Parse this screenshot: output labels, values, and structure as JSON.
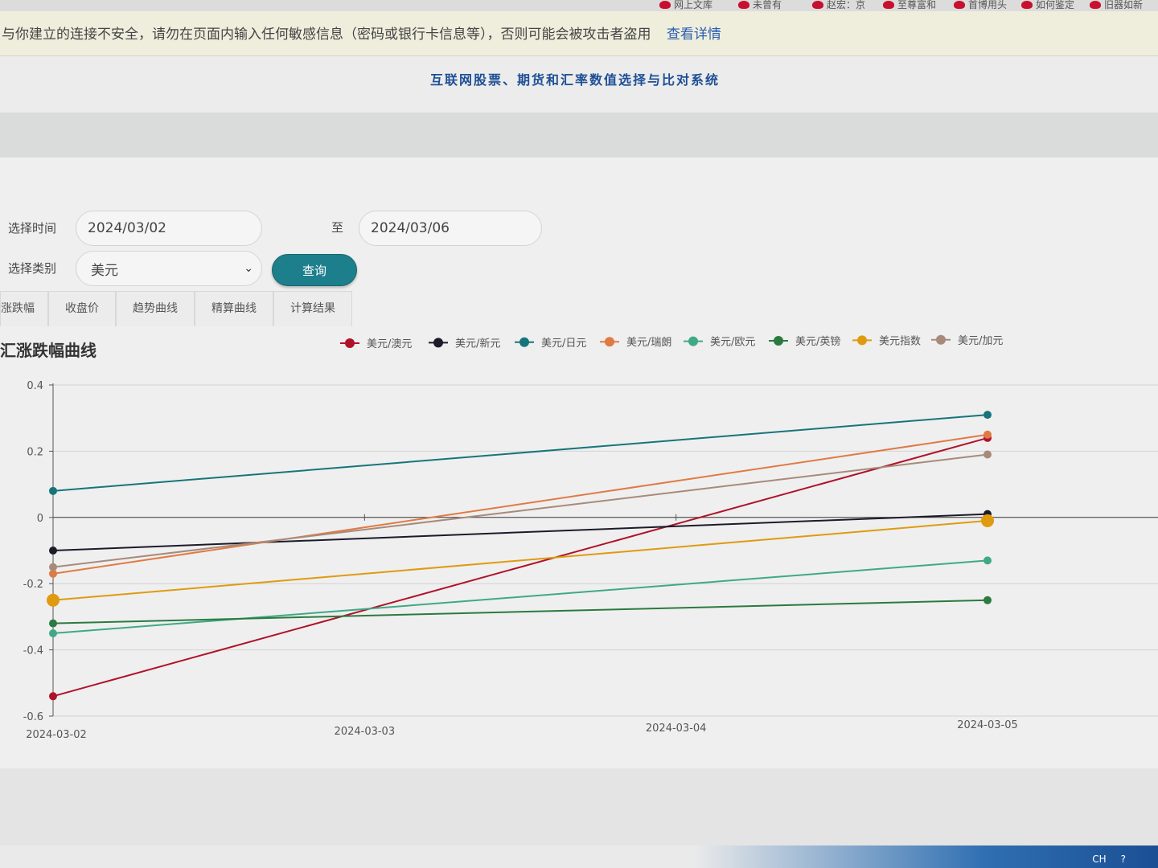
{
  "bookmarks": [
    {
      "label": "网上文库"
    },
    {
      "label": "未曾有"
    },
    {
      "label": "赵宏：京"
    },
    {
      "label": "至尊富和"
    },
    {
      "label": "首博用头"
    },
    {
      "label": "如何鉴定"
    },
    {
      "label": "旧器如新"
    }
  ],
  "warning": {
    "text": "与你建立的连接不安全，请勿在页面内输入任何敏感信息（密码或银行卡信息等），否则可能会被攻击者盗用",
    "link": "查看详情"
  },
  "header": {
    "title": "互联网股票、期货和汇率数值选择与比对系统"
  },
  "form": {
    "time_label": "选择时间",
    "start_date": "2024/03/02",
    "to_label": "至",
    "end_date": "2024/03/06",
    "category_label": "选择类别",
    "category_value": "美元",
    "query_button": "查询"
  },
  "tabs": [
    {
      "label": "涨跌幅"
    },
    {
      "label": "收盘价"
    },
    {
      "label": "趋势曲线"
    },
    {
      "label": "精算曲线"
    },
    {
      "label": "计算结果"
    }
  ],
  "chart_title": "汇涨跌幅曲线",
  "chart_data": {
    "type": "line",
    "title": "汇涨跌幅曲线",
    "x": [
      "2024-03-02",
      "2024-03-03",
      "2024-03-04",
      "2024-03-05"
    ],
    "y_ticks": [
      "0.4",
      "0.2",
      "0",
      "-0.2",
      "-0.4",
      "-0.6"
    ],
    "ylim": [
      -0.6,
      0.4
    ],
    "legend_position": "top",
    "series": [
      {
        "name": "美元/澳元",
        "color": "#b0122a",
        "x": [
          "2024-03-02",
          "2024-03-05"
        ],
        "values": [
          -0.54,
          0.24
        ]
      },
      {
        "name": "美元/新元",
        "color": "#1b1b2b",
        "x": [
          "2024-03-02",
          "2024-03-05"
        ],
        "values": [
          -0.1,
          0.01
        ]
      },
      {
        "name": "美元/日元",
        "color": "#16757a",
        "x": [
          "2024-03-02",
          "2024-03-05"
        ],
        "values": [
          0.08,
          0.31
        ]
      },
      {
        "name": "美元/瑞朗",
        "color": "#e07a45",
        "x": [
          "2024-03-02",
          "2024-03-05"
        ],
        "values": [
          -0.17,
          0.25
        ]
      },
      {
        "name": "美元/欧元",
        "color": "#3fa987",
        "x": [
          "2024-03-02",
          "2024-03-05"
        ],
        "values": [
          -0.35,
          -0.13
        ]
      },
      {
        "name": "美元/英镑",
        "color": "#2b7a3f",
        "x": [
          "2024-03-02",
          "2024-03-05"
        ],
        "values": [
          -0.32,
          -0.25
        ]
      },
      {
        "name": "美元指数",
        "color": "#e09a10",
        "x": [
          "2024-03-02",
          "2024-03-05"
        ],
        "values": [
          -0.25,
          -0.01
        ]
      },
      {
        "name": "美元/加元",
        "color": "#a88a7a",
        "x": [
          "2024-03-02",
          "2024-03-05"
        ],
        "values": [
          -0.15,
          0.19
        ]
      }
    ]
  },
  "tray": {
    "lang": "CH",
    "help": "?"
  }
}
